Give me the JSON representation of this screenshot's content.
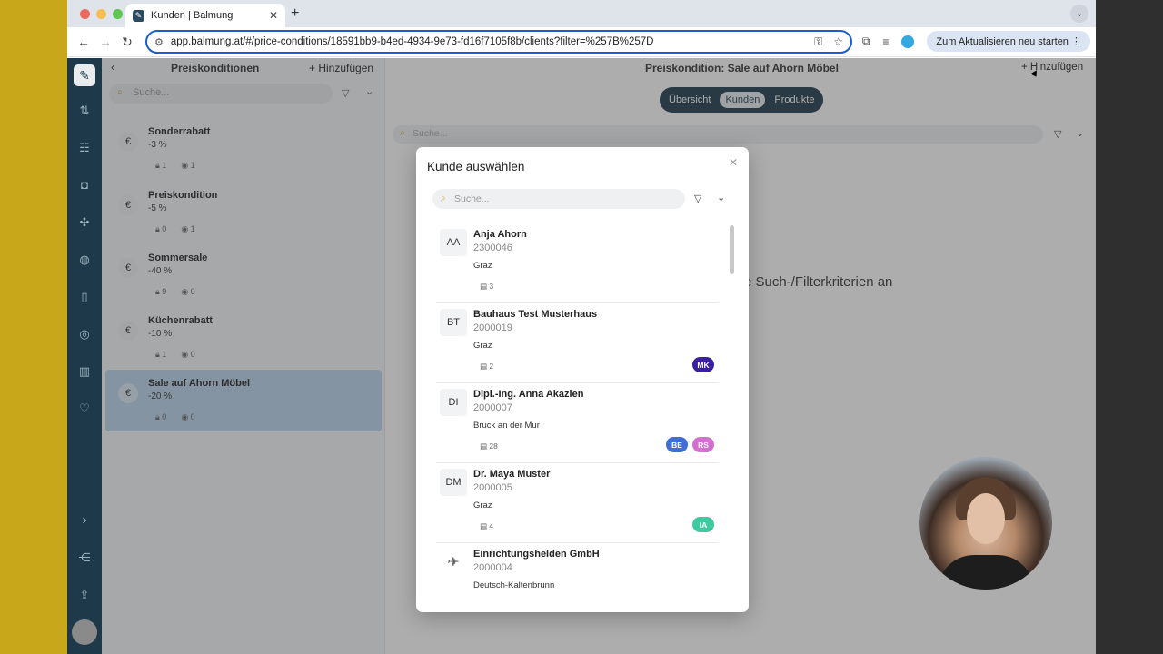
{
  "browser": {
    "tab_title": "Kunden | Balmung",
    "url": "app.balmung.at/#/price-conditions/18591bb9-b4ed-4934-9e73-fd16f7105f8b/clients?filter=%257B%257D",
    "update_label": "Zum Aktualisieren neu starten",
    "colors": {
      "close": "#ed6a5e",
      "min": "#f5bf4f",
      "max": "#61c554",
      "omnibox_border": "#1a5ec9"
    }
  },
  "sidebar_rail": {
    "icons": [
      "logo-icon",
      "routing-icon",
      "users-icon",
      "shopping-bag-icon",
      "network-icon",
      "globe-icon",
      "book-icon",
      "euro-circle-icon",
      "bar-chart-icon",
      "heart-icon",
      "expand-icon",
      "share-icon",
      "upload-icon"
    ]
  },
  "list_pane": {
    "title": "Preiskonditionen",
    "add_label": "Hinzufügen",
    "search_placeholder": "Suche...",
    "items": [
      {
        "name": "Sonderrabatt",
        "percent": "-3 %",
        "locks": "1",
        "users": "1",
        "currency": "€"
      },
      {
        "name": "Preiskondition",
        "percent": "-5 %",
        "locks": "0",
        "users": "1",
        "currency": "€"
      },
      {
        "name": "Sommersale",
        "percent": "-40 %",
        "locks": "9",
        "users": "0",
        "currency": "€"
      },
      {
        "name": "Küchenrabatt",
        "percent": "-10 %",
        "locks": "1",
        "users": "0",
        "currency": "€"
      },
      {
        "name": "Sale auf Ahorn Möbel",
        "percent": "-20 %",
        "locks": "0",
        "users": "0",
        "currency": "€",
        "selected": true
      }
    ]
  },
  "detail": {
    "title": "Preiskondition: Sale auf Ahorn Möbel",
    "add_label": "Hinzufügen",
    "tabs": [
      {
        "label": "Übersicht",
        "active": false
      },
      {
        "label": "Kunden",
        "active": true
      },
      {
        "label": "Produkte",
        "active": false
      }
    ],
    "search_placeholder": "Suche...",
    "empty_text": "re Such-/Filterkriterien an"
  },
  "modal": {
    "title": "Kunde auswählen",
    "search_placeholder": "Suche...",
    "customers": [
      {
        "initials": "AA",
        "name": "Anja Ahorn",
        "number": "2300046",
        "city": "Graz",
        "docs": "3",
        "badges": []
      },
      {
        "initials": "BT",
        "name": "Bauhaus Test Musterhaus",
        "number": "2000019",
        "city": "Graz",
        "docs": "2",
        "badges": [
          {
            "label": "MK",
            "color": "#3a1f9e"
          }
        ]
      },
      {
        "initials": "DI",
        "name": "Dipl.-Ing. Anna Akazien",
        "number": "2000007",
        "city": "Bruck an der Mur",
        "docs": "28",
        "badges": [
          {
            "label": "BE",
            "color": "#3f6fd6"
          },
          {
            "label": "RS",
            "color": "#d46fcf"
          }
        ]
      },
      {
        "initials": "DM",
        "name": "Dr. Maya Muster",
        "number": "2000005",
        "city": "Graz",
        "docs": "4",
        "badges": [
          {
            "label": "IA",
            "color": "#3fc9a0"
          }
        ]
      },
      {
        "initials": "",
        "name": "Einrichtungshelden GmbH",
        "number": "2000004",
        "city": "Deutsch-Kaltenbrunn",
        "docs": "",
        "badges": []
      }
    ]
  }
}
